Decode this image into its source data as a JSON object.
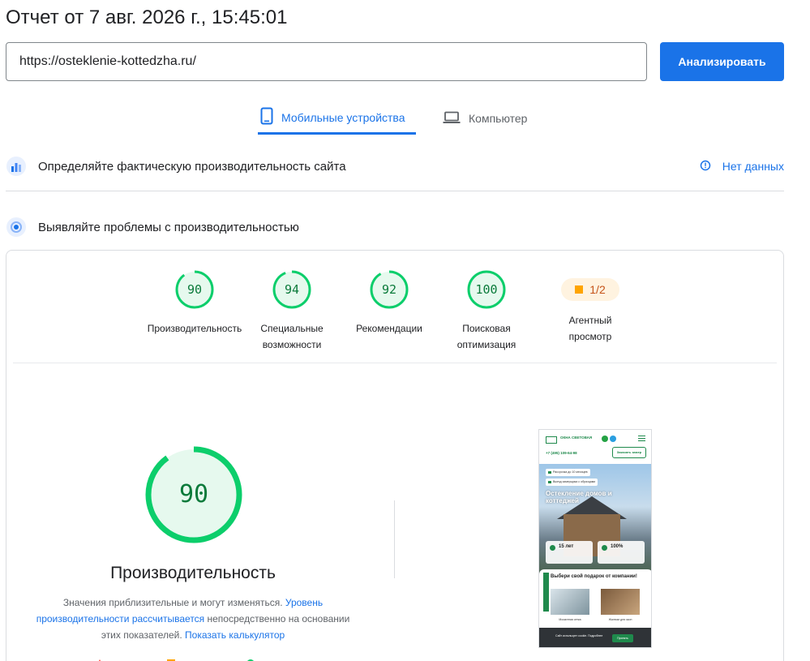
{
  "report": {
    "title": "Отчет от 7 авг. 2026 г., 15:45:01"
  },
  "search": {
    "url_value": "https://osteklenie-kottedzha.ru/",
    "analyze_label": "Анализировать"
  },
  "tabs": {
    "mobile": "Мобильные устройства",
    "desktop": "Компьютер",
    "active": "mobile"
  },
  "field_data": {
    "title": "Определяйте фактическую производительность сайта",
    "no_data": "Нет данных"
  },
  "lab_data": {
    "title": "Выявляйте проблемы с производительностью"
  },
  "scores": [
    {
      "value": 90,
      "label_lines": [
        "Производительность"
      ]
    },
    {
      "value": 94,
      "label_lines": [
        "Специальные",
        "возможности"
      ]
    },
    {
      "value": 92,
      "label_lines": [
        "Рекомендации"
      ]
    },
    {
      "value": 100,
      "label_lines": [
        "Поисковая",
        "оптимизация"
      ]
    }
  ],
  "agent": {
    "value": "1/2",
    "label_lines": [
      "Агентный",
      "просмотр"
    ]
  },
  "performance": {
    "score": 90,
    "title": "Производительность",
    "note_prefix": "Значения приблизительные и могут изменяться. ",
    "note_link1": "Уровень производительности рассчитывается",
    "note_middle": " непосредственно на основании этих показателей. ",
    "note_link2": "Показать калькулятор"
  },
  "colors": {
    "accent": "#1a73e8",
    "pass": "#0cce6b",
    "pass_bg": "#e6f9ee",
    "pass_text": "#0a7a3a",
    "average": "#ffa400",
    "fail": "#ff4e42"
  },
  "thumbnail": {
    "brand": "ОКНА СВЕТОВАЯ",
    "phone": "+7 (495) 109-64-98",
    "order_btn": "Заказать замер",
    "badge1": "Рассрочка до 10 месяцев",
    "badge2": "Выезд замерщика с образцами",
    "hero_title": "Остекление домов и коттеджей",
    "stat1": "15 лет",
    "stat2": "100%",
    "gift_title": "Выбери свой подарок от компании!",
    "side_text": "ОСЕНЬ",
    "cap1": "Москитная сетка",
    "cap2": "Жалюзи для окон",
    "cookie_text": "Сайт использует cookie. Подробнее",
    "cookie_btn": "Принять"
  }
}
